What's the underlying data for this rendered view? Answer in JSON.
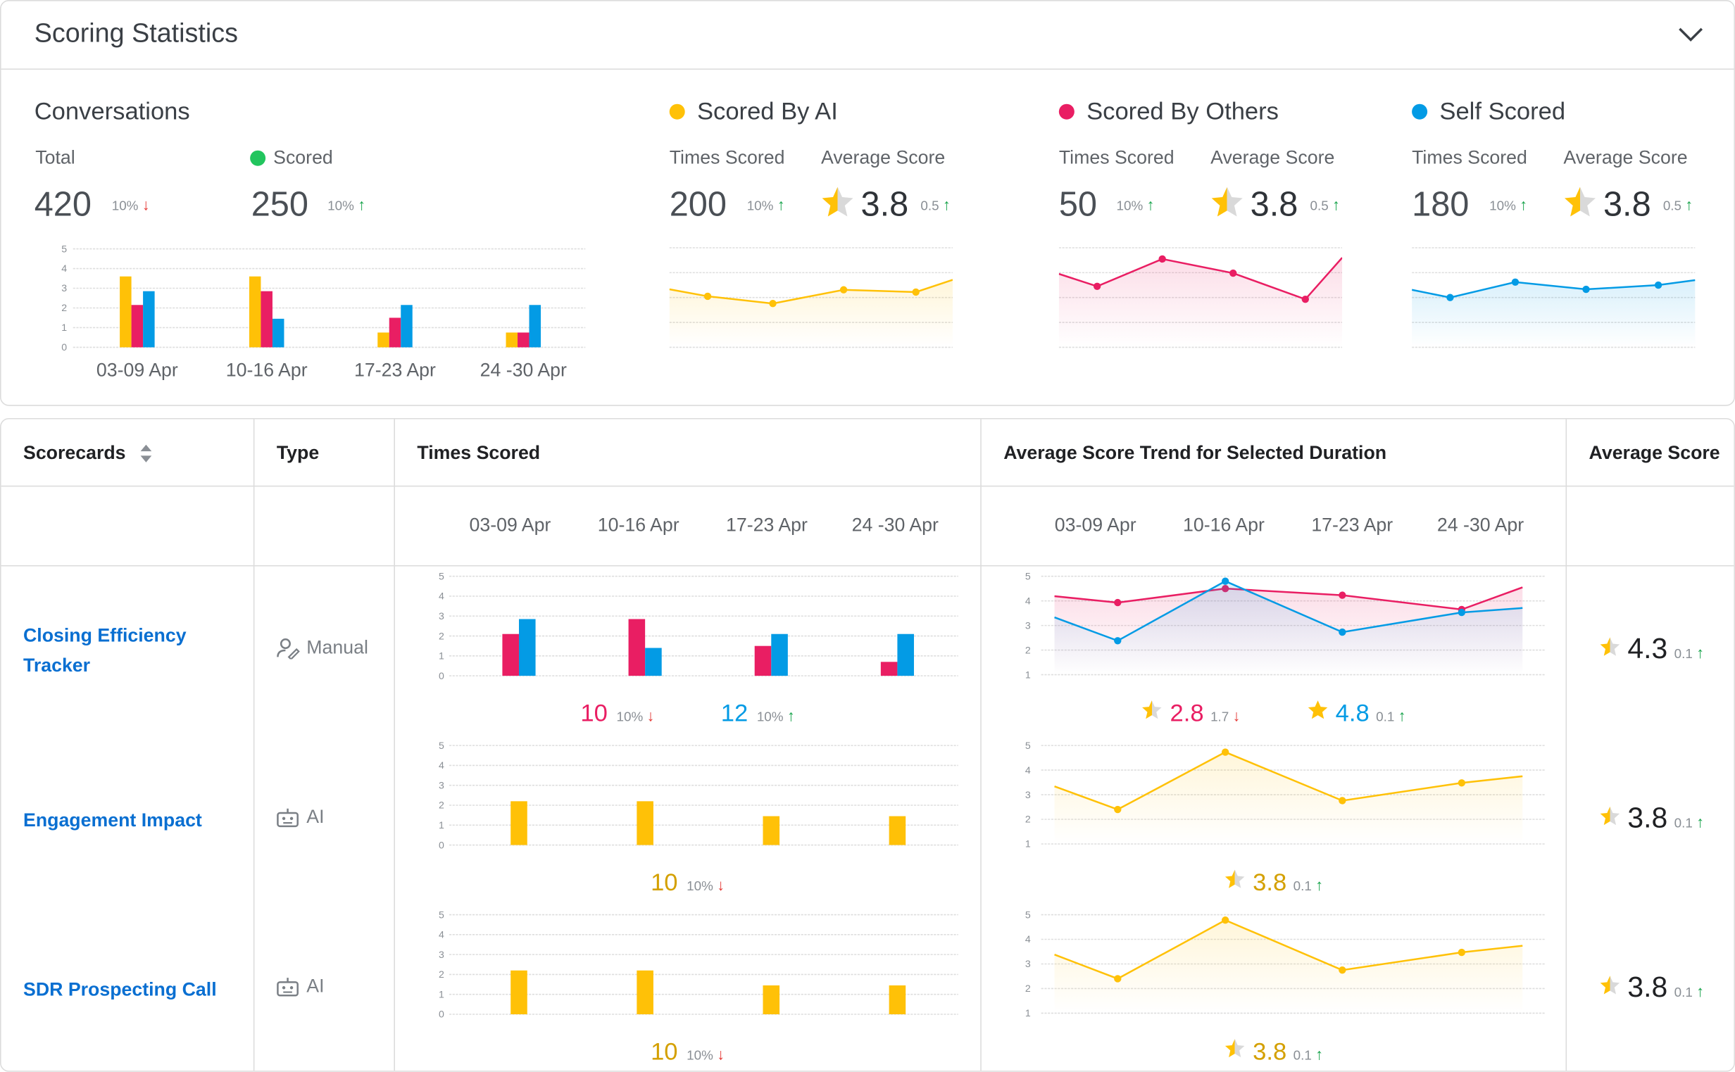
{
  "header": {
    "title": "Scoring Statistics",
    "collapse_icon": "chevron-down-icon"
  },
  "colors": {
    "ai": "#FFC107",
    "others": "#E91E63",
    "self": "#039BE5",
    "scored": "#22C55E",
    "ai_text": "#D4A000",
    "star": "#FFC107",
    "star_empty": "#D9D9D9"
  },
  "conversations": {
    "title": "Conversations",
    "total_label": "Total",
    "total": "420",
    "total_change": "10%",
    "total_dir": "down",
    "scored_label": "Scored",
    "scored": "250",
    "scored_change": "10%",
    "scored_dir": "up"
  },
  "groups": [
    {
      "title": "Scored By AI",
      "color": "#FFC107",
      "times_label": "Times Scored",
      "times": "200",
      "times_change": "10%",
      "times_dir": "up",
      "avg_label": "Average Score",
      "avg": "3.8",
      "avg_change": "0.5",
      "avg_dir": "up"
    },
    {
      "title": "Scored By Others",
      "color": "#E91E63",
      "times_label": "Times Scored",
      "times": "50",
      "times_change": "10%",
      "times_dir": "up",
      "avg_label": "Average Score",
      "avg": "3.8",
      "avg_change": "0.5",
      "avg_dir": "up"
    },
    {
      "title": "Self Scored",
      "color": "#039BE5",
      "times_label": "Times Scored",
      "times": "180",
      "times_change": "10%",
      "times_dir": "up",
      "avg_label": "Average Score",
      "avg": "3.8",
      "avg_change": "0.5",
      "avg_dir": "up"
    }
  ],
  "table": {
    "columns": {
      "scorecards": "Scorecards",
      "type": "Type",
      "times": "Times Scored",
      "trend": "Average Score Trend for Selected Duration",
      "avg": "Average Score"
    },
    "sort_icon": "sort-icon",
    "periods": [
      "03-09 Apr",
      "10-16 Apr",
      "17-23 Apr",
      "24 -30 Apr"
    ],
    "rows": [
      {
        "name": "Closing Efficiency Tracker",
        "type": "Manual",
        "type_icon": "user-edit-icon",
        "times_summary": [
          {
            "value": "10",
            "change": "10%",
            "dir": "down",
            "color": "#E91E63"
          },
          {
            "value": "12",
            "change": "10%",
            "dir": "up",
            "color": "#039BE5"
          }
        ],
        "trend_summary": [
          {
            "value": "2.8",
            "change": "1.7",
            "dir": "down",
            "color": "#E91E63",
            "star_fill": 0.5
          },
          {
            "value": "4.8",
            "change": "0.1",
            "dir": "up",
            "color": "#039BE5",
            "star_fill": 1
          }
        ],
        "avg": "4.3",
        "avg_change": "0.1",
        "avg_dir": "up"
      },
      {
        "name": "Engagement Impact",
        "type": "AI",
        "type_icon": "robot-icon",
        "times_summary": [
          {
            "value": "10",
            "change": "10%",
            "dir": "down",
            "color": "#D4A000"
          }
        ],
        "trend_summary": [
          {
            "value": "3.8",
            "change": "0.1",
            "dir": "up",
            "color": "#D4A000",
            "star_fill": 0.5
          }
        ],
        "avg": "3.8",
        "avg_change": "0.1",
        "avg_dir": "up"
      },
      {
        "name": "SDR Prospecting Call",
        "type": "AI",
        "type_icon": "robot-icon",
        "times_summary": [
          {
            "value": "10",
            "change": "10%",
            "dir": "down",
            "color": "#D4A000"
          }
        ],
        "trend_summary": [
          {
            "value": "3.8",
            "change": "0.1",
            "dir": "up",
            "color": "#D4A000",
            "star_fill": 0.5
          }
        ],
        "avg": "3.8",
        "avg_change": "0.1",
        "avg_dir": "up"
      }
    ]
  },
  "chart_data": [
    {
      "id": "conversations",
      "type": "bar",
      "categories": [
        "03-09 Apr",
        "10-16 Apr",
        "17-23 Apr",
        "24 -30 Apr"
      ],
      "ylim": [
        0,
        5
      ],
      "yticks": [
        "0",
        "1",
        "2",
        "3",
        "4",
        "5"
      ],
      "grid": true,
      "series": [
        {
          "color": "#FFC107",
          "values": [
            3.6,
            3.6,
            0.75,
            0.75
          ]
        },
        {
          "color": "#E91E63",
          "values": [
            2.15,
            2.85,
            1.5,
            0.75
          ]
        },
        {
          "color": "#039BE5",
          "values": [
            2.85,
            1.45,
            2.15,
            2.15
          ]
        }
      ]
    },
    {
      "id": "ai-sparkline",
      "type": "area",
      "ylim": [
        0,
        4
      ],
      "grid": true,
      "series": [
        {
          "color": "#FFC107",
          "lead": 2.33,
          "values": [
            2.05,
            1.76,
            2.31,
            2.22
          ],
          "trail": 2.71
        }
      ]
    },
    {
      "id": "others-sparkline",
      "type": "area",
      "ylim": [
        0,
        4
      ],
      "grid": true,
      "series": [
        {
          "color": "#E91E63",
          "lead": 2.95,
          "values": [
            2.45,
            3.55,
            2.98,
            1.93
          ],
          "trail": 3.6
        }
      ]
    },
    {
      "id": "self-sparkline",
      "type": "area",
      "ylim": [
        0,
        4
      ],
      "grid": true,
      "series": [
        {
          "color": "#039BE5",
          "lead": 2.31,
          "values": [
            2.0,
            2.62,
            2.33,
            2.5
          ],
          "trail": 2.7
        }
      ]
    },
    {
      "id": "row1-times",
      "type": "bar",
      "ylim": [
        0,
        5
      ],
      "yticks": [
        "0",
        "1",
        "2",
        "3",
        "4",
        "5"
      ],
      "grid": true,
      "series": [
        {
          "color": "#E91E63",
          "values": [
            2.1,
            2.85,
            1.5,
            0.7
          ]
        },
        {
          "color": "#039BE5",
          "values": [
            2.85,
            1.4,
            2.1,
            2.1
          ]
        }
      ]
    },
    {
      "id": "row1-trend",
      "type": "area",
      "ylim": [
        1,
        5
      ],
      "yticks": [
        "1",
        "2",
        "3",
        "4",
        "5"
      ],
      "grid": true,
      "series": [
        {
          "color": "#E91E63",
          "lead": 4.19,
          "values": [
            3.93,
            4.5,
            4.23,
            3.65
          ],
          "trail": 4.55
        },
        {
          "color": "#039BE5",
          "lead": 3.33,
          "values": [
            2.38,
            4.8,
            2.73,
            3.53
          ],
          "trail": 3.71
        }
      ]
    },
    {
      "id": "row2-times",
      "type": "bar",
      "ylim": [
        0,
        5
      ],
      "yticks": [
        "0",
        "1",
        "2",
        "3",
        "4",
        "5"
      ],
      "grid": true,
      "series": [
        {
          "color": "#FFC107",
          "values": [
            2.2,
            2.2,
            1.45,
            1.45
          ]
        }
      ]
    },
    {
      "id": "row2-trend",
      "type": "area",
      "ylim": [
        1,
        5
      ],
      "yticks": [
        "1",
        "2",
        "3",
        "4",
        "5"
      ],
      "grid": true,
      "series": [
        {
          "color": "#FFC107",
          "lead": 3.34,
          "values": [
            2.4,
            4.73,
            2.76,
            3.48
          ],
          "trail": 3.75
        }
      ]
    },
    {
      "id": "row3-times",
      "type": "bar",
      "ylim": [
        0,
        5
      ],
      "yticks": [
        "0",
        "1",
        "2",
        "3",
        "4",
        "5"
      ],
      "grid": true,
      "series": [
        {
          "color": "#FFC107",
          "values": [
            2.2,
            2.2,
            1.45,
            1.45
          ]
        }
      ]
    },
    {
      "id": "row3-trend",
      "type": "area",
      "ylim": [
        1,
        5
      ],
      "yticks": [
        "1",
        "2",
        "3",
        "4",
        "5"
      ],
      "grid": true,
      "series": [
        {
          "color": "#FFC107",
          "lead": 3.38,
          "values": [
            2.4,
            4.78,
            2.75,
            3.47
          ],
          "trail": 3.74
        }
      ]
    }
  ]
}
